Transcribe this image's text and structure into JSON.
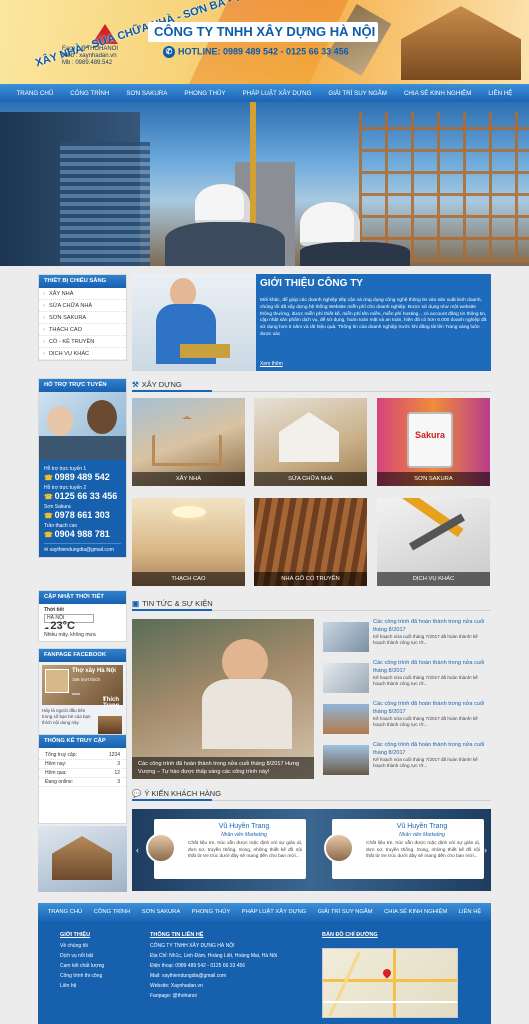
{
  "header": {
    "logo_text": "XÂY NHÀ - SỬA CHỮA NHÀ - SƠN BẢ - THẠCH CAO",
    "logo_info": [
      "Face : @THOHANOI",
      "Web : xaynhadan.vn",
      "Mb : 0989.489.542"
    ],
    "company": "CÔNG TY TNHH XÂY DỰNG HÀ NỘI",
    "hotline": "HOTLINE: 0989 489 542 - 0125 66 33 456"
  },
  "nav": [
    "TRANG CHỦ",
    "CÔNG TRÌNH",
    "SƠN SAKURA",
    "PHONG THỦY",
    "PHÁP LUẬT XÂY DỰNG",
    "GIẢI TRÍ SUY NGẪM",
    "CHIA SẺ KINH NGHIỆM",
    "LIÊN HỆ"
  ],
  "sidebar": {
    "categories_title": "THIẾT BỊ CHIẾU SÁNG",
    "categories": [
      "XÂY NHÀ",
      "SỬA CHỮA NHÀ",
      "SƠN SAKURA",
      "THẠCH CAO",
      "CỔ - KÊ TRUYỀN",
      "DỊCH VỤ KHÁC"
    ],
    "support_title": "HỖ TRỢ TRỰC TUYẾN",
    "support": [
      {
        "label": "Hỗ trợ trực tuyến 1",
        "phone": "0989 489 542"
      },
      {
        "label": "Hỗ trợ trực tuyến 2",
        "phone": "0125 66 33 456"
      },
      {
        "label": "Sơn Sakura",
        "phone": "0978 661 303"
      },
      {
        "label": "Trần thạch cao",
        "phone": "0904 988 781"
      }
    ],
    "support_email": "xaythiendungdia@gmail.com",
    "weather_title": "CẬP NHẬT THỜI TIẾT",
    "weather_label": "Thời tiết",
    "weather_city": "HÀ NỘI",
    "weather_temp": "23°C",
    "weather_desc": "Nhiều mây, không mưa",
    "fb_title": "FANPAGE FACEBOOK",
    "fb_page": "Thợ xây Hà Nội",
    "fb_likes": "156 lượt thích",
    "fb_like_btn": "Thích Trang",
    "fb_post": "Hãy là người đầu tiên trong số bạn bè của bạn thích nội dung này",
    "stats_title": "THỐNG KÊ TRUY CẬP",
    "stats": [
      {
        "label": "Tổng truy cập:",
        "value": "1234"
      },
      {
        "label": "Hôm nay:",
        "value": "3"
      },
      {
        "label": "Hôm qua:",
        "value": "12"
      },
      {
        "label": "Đang online:",
        "value": "3"
      }
    ]
  },
  "intro": {
    "title": "GIỚI THIỆU CÔNG TY",
    "text": "Mời khác, để giúp các doanh nghiệp tiếp cận và ứng dụng công nghệ thông tin vào sản xuất kinh doanh, chúng tôi đã xây dựng hệ thống Website miễn phí cho doanh nghiệp. Được sử dụng như một website thông thường, được miễn phí thiết kế, miễn phí tên miền, miễn phí hosting... có account đăng tin thông tin, cập nhật sản phẩm dịch vụ, để sử dụng, hoàn toàn mặt và an toàn, hiện đã có hơn 6.000 doanh nghiệp đã sử dụng hơn 5 năm và rất hiệu quả. Thông tin của doanh nghiệp trước khi đăng tải lên Trang vàng luôn được xác",
    "more": "Xem thêm"
  },
  "section_build": "XÂY DỰNG",
  "tiles": [
    "XÂY NHÀ",
    "SỬA CHỮA NHÀ",
    "SƠN SAKURA",
    "THẠCH CAO",
    "NHÀ GỖ CỔ TRUYỀN",
    "DỊCH VỤ KHÁC"
  ],
  "section_news": "TIN TỨC & SỰ KIỆN",
  "news_big_caption": "Các công trình đã hoàn thành trong nửa cuối tháng 8/2017 Hưng Vượng – Tự hào được thấp sáng các công trình này!",
  "news": [
    {
      "title": "Các công trình đã hoàn thành trong nửa cuối tháng 8/2017",
      "excerpt": "Kế hoạch nửa cuối tháng 7/2017 đã hoàn thành! kế hoạch thành công rực rỡ..."
    },
    {
      "title": "Các công trình đã hoàn thành trong nửa cuối tháng 8/2017",
      "excerpt": "Kế hoạch nửa cuối tháng 7/2017 đã hoàn thành! kế hoạch thành công rực rỡ..."
    },
    {
      "title": "Các công trình đã hoàn thành trong nửa cuối tháng 8/2017",
      "excerpt": "Kế hoạch nửa cuối tháng 7/2017 đã hoàn thành! kế hoạch thành công rực rỡ..."
    },
    {
      "title": "Các công trình đã hoàn thành trong nửa cuối tháng 8/2017",
      "excerpt": "Kế hoạch nửa cuối tháng 7/2017 đã hoàn thành! kế hoạch thành công rực rỡ..."
    }
  ],
  "section_testimonials": "Ý KIẾN KHÁCH HÀNG",
  "testimonials": [
    {
      "name": "Vũ Huyền Trang",
      "position": "Nhân viên Marketing",
      "text": "Chất liệu tre, trúc vẫn được mặc định với sự giản dị, đơn sơ, truyền thống. Song, những thiết kế đồ nội thất từ tre trúc dưới đây sẽ mang đến cho ban mới..."
    },
    {
      "name": "Vũ Huyền Trang",
      "position": "Nhân viên Marketing",
      "text": "Chất liệu tre, trúc vẫn được mặc định với sự giản dị, đơn sơ, truyền thống. Song, những thiết kế đồ nội thất từ tre trúc dưới đây sẽ mang đến cho ban mới..."
    }
  ],
  "footer": {
    "nav": [
      "TRANG CHỦ",
      "CÔNG TRÌNH",
      "SƠN SAKURA",
      "PHONG THỦY",
      "PHÁP LUẬT XÂY DỰNG",
      "GIẢI TRÍ SUY NGẪM",
      "CHIA SẺ KINH NGHIỆM",
      "LIÊN HỆ"
    ],
    "col1_title": "GIỚI THIỆU",
    "col1": [
      "Về chúng tôi",
      "Dịch vụ nổi bật",
      "Cam kết chất lượng",
      "Công trình thi công",
      "Liên hệ"
    ],
    "col2_title": "THÔNG TIN LIÊN HỆ",
    "col2": [
      "CÔNG TY TNHH XÂY DỰNG HÀ NỘI",
      "Địa Chỉ: Nh1c, Linh Đàm, Hoàng Liệt, Hoàng Mai, Hà Nội",
      "Điện thoại: 0989 489 542 - 0125 66 33 456",
      "Mail: xaythiendungdia@gmail.com",
      "Website: Xaynhadan.vn",
      "Fanpage: @thohanoi"
    ],
    "col3_title": "BẢN ĐỒ CHỈ ĐƯỜNG"
  },
  "colors": {
    "primary": "#1760ad",
    "nav_top": "#3c8fd9",
    "accent": "#f3c32a"
  }
}
